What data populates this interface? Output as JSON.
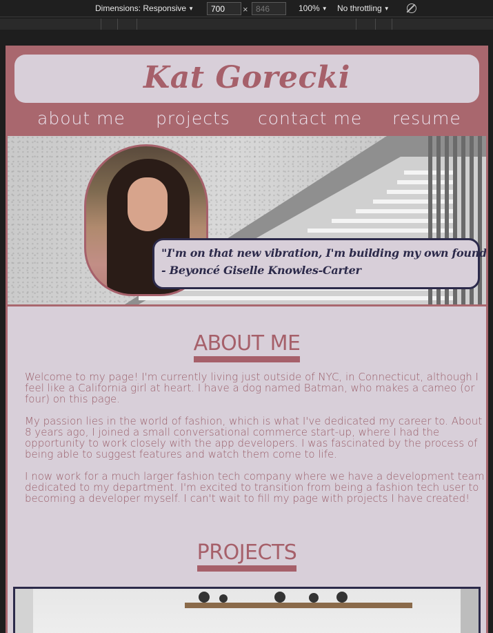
{
  "devtools": {
    "dimensions_label": "Dimensions: Responsive",
    "width_value": "700",
    "height_placeholder": "846",
    "times": "×",
    "zoom": "100%",
    "throttling": "No throttling",
    "caret": "▼"
  },
  "site": {
    "name": "Kat Gorecki",
    "nav": [
      "about me",
      "projects",
      "contact me",
      "resume"
    ],
    "quote_line1": "\"I'm on that new vibration, I'm building my own foundation\"",
    "quote_line2": "- Beyoncé Giselle Knowles-Carter",
    "about_title": "ABOUT ME",
    "about_paragraphs": [
      "Welcome to my page! I'm currently living just outside of NYC, in Connecticut, although I feel like a California girl at heart. I have a dog named Batman, who makes a cameo (or four) on this page.",
      "My passion lies in the world of fashion, which is what I've dedicated my career to. About 8 years ago, I joined a small conversational commerce start-up, where I had the opportunity to work closely with the app developers. I was fascinated by the process of being able to suggest features and watch them come to life.",
      "I now work for a much larger fashion tech company where we have a development team dedicated to my department. I'm excited to transition from being a fashion tech user to becoming a developer myself. I can't wait to fill my page with projects I have created!"
    ],
    "projects_title": "PROJECTS"
  },
  "colors": {
    "accent": "#a6606a",
    "panel": "#d8cfd9",
    "outline": "#2c2a4a"
  }
}
